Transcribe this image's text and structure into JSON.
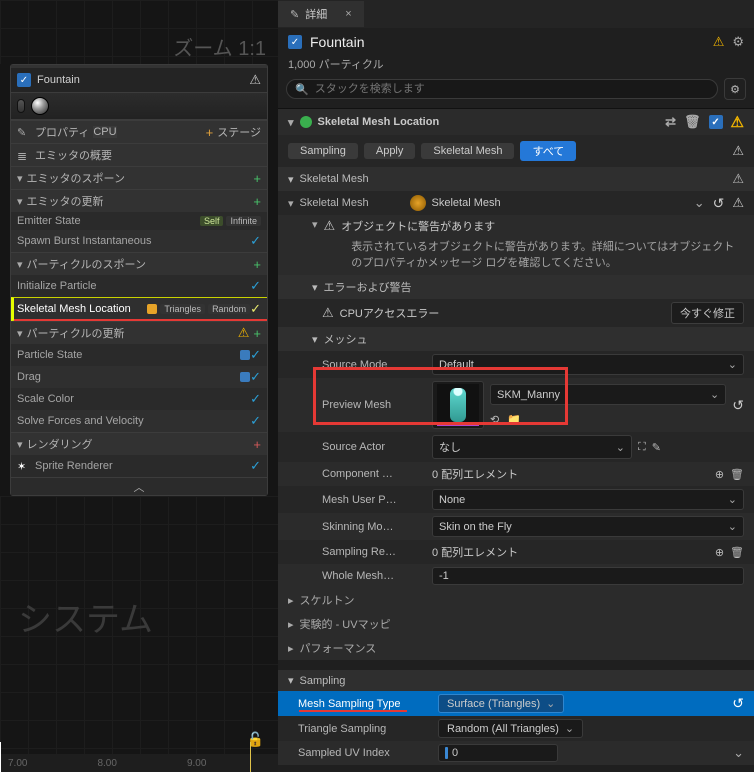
{
  "zoom_label": "ズーム 1:1",
  "emitter": {
    "name": "Fountain",
    "property_label": "プロパティ",
    "cpu_badge": "CPU",
    "stage_label": "ステージ",
    "groups": {
      "overview": "エミッタの概要",
      "emitter_spawn": "エミッタのスポーン",
      "emitter_update": "エミッタの更新",
      "particle_spawn": "パーティクルのスポーン",
      "particle_update": "パーティクルの更新",
      "rendering": "レンダリング"
    },
    "modules": {
      "emitter_state": "Emitter State",
      "emitter_state_self": "Self",
      "emitter_state_infinite": "Infinite",
      "spawn_burst": "Spawn Burst Instantaneous",
      "initialize_particle": "Initialize Particle",
      "skel_mesh_loc": "Skeletal Mesh Location",
      "skel_tag_triangles": "Triangles",
      "skel_tag_random": "Random",
      "particle_state": "Particle State",
      "drag": "Drag",
      "scale_color": "Scale Color",
      "solve": "Solve Forces and Velocity",
      "sprite_renderer": "Sprite Renderer"
    }
  },
  "system_watermark": "システム",
  "timeline": {
    "t0": "7.00",
    "t1": "8.00",
    "t2": "9.00"
  },
  "details": {
    "tab": "詳細",
    "title": "Fountain",
    "count": "1,000 パーティクル",
    "search_placeholder": "スタックを検索します",
    "module_title": "Skeletal Mesh Location",
    "pills": {
      "sampling": "Sampling",
      "apply": "Apply",
      "skel_mesh": "Skeletal Mesh",
      "all": "すべて"
    },
    "sections": {
      "skel_mesh_cat": "Skeletal Mesh",
      "skel_mesh_prop": "Skeletal Mesh",
      "skel_mesh_value": "Skeletal Mesh",
      "warn_hdr": "オブジェクトに警告があります",
      "warn_body": "表示されているオブジェクトに警告があります。詳細についてはオブジェクトのプロパティかメッセージ ログを確認してください。",
      "err_warn_hdr": "エラーおよび警告",
      "cpu_access_err": "CPUアクセスエラー",
      "fix_now": "今すぐ修正",
      "mesh_hdr": "メッシュ",
      "source_mode": "Source Mode",
      "source_mode_val": "Default",
      "preview_mesh": "Preview Mesh",
      "preview_mesh_val": "SKM_Manny",
      "source_actor": "Source Actor",
      "source_actor_val": "なし",
      "component_tags": "Component …",
      "component_tags_val": "0 配列エレメント",
      "mesh_user_p": "Mesh User P…",
      "mesh_user_p_val": "None",
      "skinning_mode": "Skinning Mo…",
      "skinning_mode_val": "Skin on the Fly",
      "sampling_re": "Sampling Re…",
      "sampling_re_val": "0 配列エレメント",
      "whole_mesh": "Whole Mesh…",
      "whole_mesh_val": "-1",
      "skeleton": "スケルトン",
      "exp_uvmap": "実験的 - UVマッピ",
      "performance": "パフォーマンス",
      "sampling_cat": "Sampling",
      "mesh_sampling_type": "Mesh Sampling Type",
      "mesh_sampling_type_val": "Surface (Triangles)",
      "triangle_sampling": "Triangle Sampling",
      "triangle_sampling_val": "Random (All Triangles)",
      "sampled_uv_index": "Sampled UV Index",
      "sampled_uv_index_val": "0"
    }
  }
}
